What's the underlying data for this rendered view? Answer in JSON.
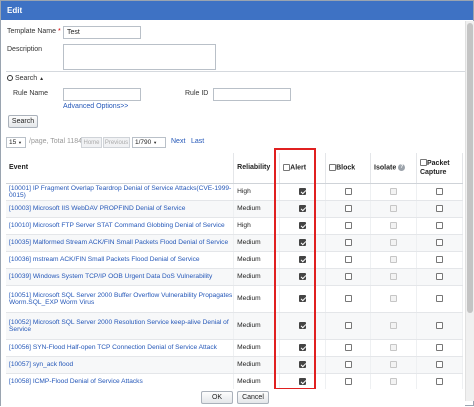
{
  "dialog": {
    "title": "Edit"
  },
  "form": {
    "template_name_label": "Template Name",
    "required_mark": "*",
    "template_name_value": "Test",
    "description_label": "Description",
    "description_value": ""
  },
  "search": {
    "toggle_label": "Search",
    "toggle_arrow": "▲",
    "rule_name_label": "Rule Name",
    "rule_id_label": "Rule ID",
    "advanced_link": "Advanced Options>>",
    "search_button": "Search"
  },
  "pagination": {
    "per_page": "15",
    "per_page_arrow": "▼",
    "page_total_text": "/page, Total 11847",
    "home": "Home",
    "previous": "Previous",
    "page_value": "1/790",
    "next": "Next",
    "last": "Last"
  },
  "table": {
    "headers": {
      "event": "Event",
      "reliability": "Reliability",
      "alert": "Alert",
      "block": "Block",
      "isolate": "Isolate",
      "packet_capture_1": "Packet",
      "packet_capture_2": "Capture"
    },
    "rows": [
      {
        "event": "[10001] IP Fragment Overlap Teardrop Denial of Service Attacks(CVE-1999-0015)",
        "reliability": "High"
      },
      {
        "event": "[10003] Microsoft IIS WebDAV PROPFIND Denial of Service",
        "reliability": "Medium"
      },
      {
        "event": "[10010] Microsoft FTP Server STAT Command Globbing Denial of Service",
        "reliability": "High"
      },
      {
        "event": "[10035] Malformed Stream ACK/FIN Small Packets Flood Denial of Service",
        "reliability": "Medium"
      },
      {
        "event": "[10036] mstream ACK/FIN Small Packets Flood Denial of Service",
        "reliability": "Medium"
      },
      {
        "event": "[10039] Windows System TCP/IP OOB Urgent Data DoS Vulnerability",
        "reliability": "Medium"
      },
      {
        "event": "[10051] Microsoft SQL Server 2000 Buffer Overflow Vulnerability Propagates Worm.SQL_EXP Worm Virus",
        "reliability": "Medium"
      },
      {
        "event": "[10052] Microsoft SQL Server 2000 Resolution Service keep-alive Denial of Service",
        "reliability": "Medium"
      },
      {
        "event": "[10056] SYN-Flood Half-open TCP Connection Denial of Service Attack",
        "reliability": "Medium"
      },
      {
        "event": "[10057] syn_ack flood",
        "reliability": "Medium"
      },
      {
        "event": "[10058] ICMP-Flood Denial of Service Attacks",
        "reliability": "Medium"
      }
    ]
  },
  "footer": {
    "ok": "OK",
    "cancel": "Cancel"
  },
  "colors": {
    "title_bar": "#3e72c4",
    "link": "#2457b8",
    "highlight_box": "#e02020"
  }
}
